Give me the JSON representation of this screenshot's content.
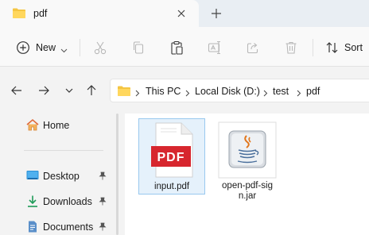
{
  "tab": {
    "title": "pdf",
    "new_tab": "+"
  },
  "command_bar": {
    "new_label": "New",
    "sort_label": "Sort",
    "icons": [
      "cut-icon",
      "copy-icon",
      "paste-icon",
      "rename-icon",
      "share-icon",
      "delete-icon"
    ]
  },
  "address": {
    "crumbs": [
      "This PC",
      "Local Disk (D:)",
      "test",
      "pdf"
    ]
  },
  "sidebar": {
    "items": [
      {
        "label": "Home",
        "icon": "home-icon"
      },
      {
        "label": "Desktop",
        "icon": "desktop-icon",
        "pinned": true
      },
      {
        "label": "Downloads",
        "icon": "downloads-icon",
        "pinned": true
      },
      {
        "label": "Documents",
        "icon": "documents-icon",
        "pinned": true
      }
    ]
  },
  "files": [
    {
      "name": "input.pdf",
      "type": "pdf",
      "badge": "PDF",
      "selected": true
    },
    {
      "name_line1": "open-pdf-sig",
      "name_line2": "n.jar",
      "type": "jar"
    }
  ],
  "colors": {
    "folder": "#f4c542",
    "pdf_red": "#d7262e",
    "selection": "#e5f1fb",
    "accent": "#0067c0"
  }
}
